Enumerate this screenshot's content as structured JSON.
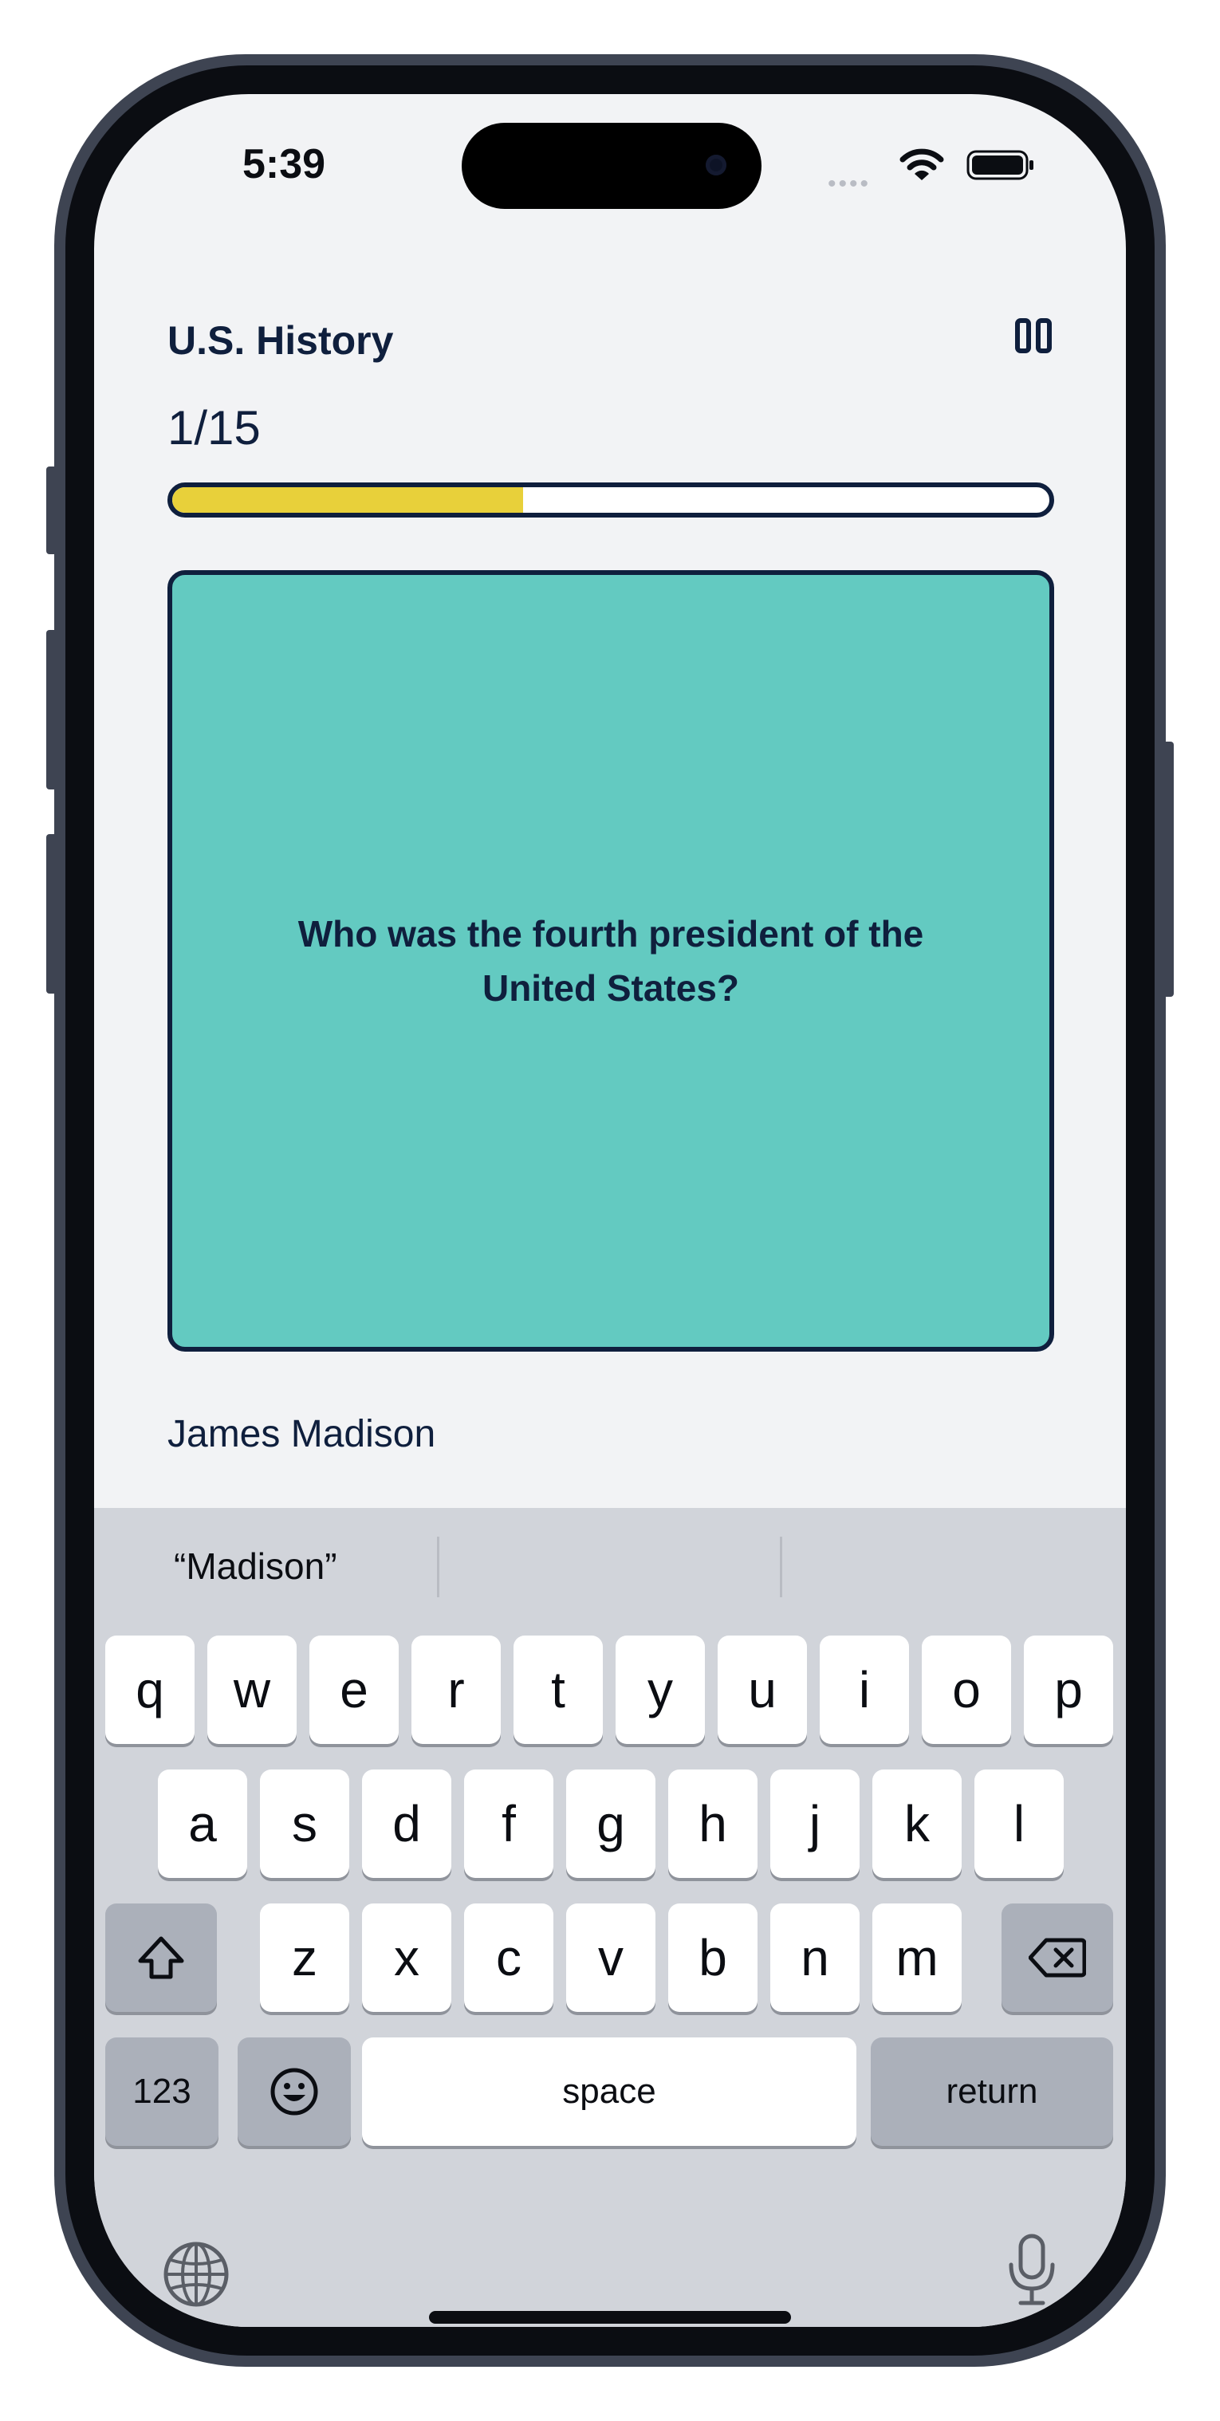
{
  "status_bar": {
    "time": "5:39",
    "signal": "•••• "
  },
  "header": {
    "deck_title": "U.S. History",
    "counter": "1/15"
  },
  "progress": {
    "fraction": 0.4,
    "fill_color": "#e8d03a"
  },
  "card": {
    "question": "Who was the fourth president of the United States?",
    "color": "#63cac1"
  },
  "answer": {
    "value": "James Madison"
  },
  "keyboard": {
    "suggestions": [
      "“Madison”",
      "",
      ""
    ],
    "row1": [
      "q",
      "w",
      "e",
      "r",
      "t",
      "y",
      "u",
      "i",
      "o",
      "p"
    ],
    "row2": [
      "a",
      "s",
      "d",
      "f",
      "g",
      "h",
      "j",
      "k",
      "l"
    ],
    "row3": [
      "z",
      "x",
      "c",
      "v",
      "b",
      "n",
      "m"
    ],
    "numbers_label": "123",
    "space_label": "space",
    "return_label": "return"
  }
}
